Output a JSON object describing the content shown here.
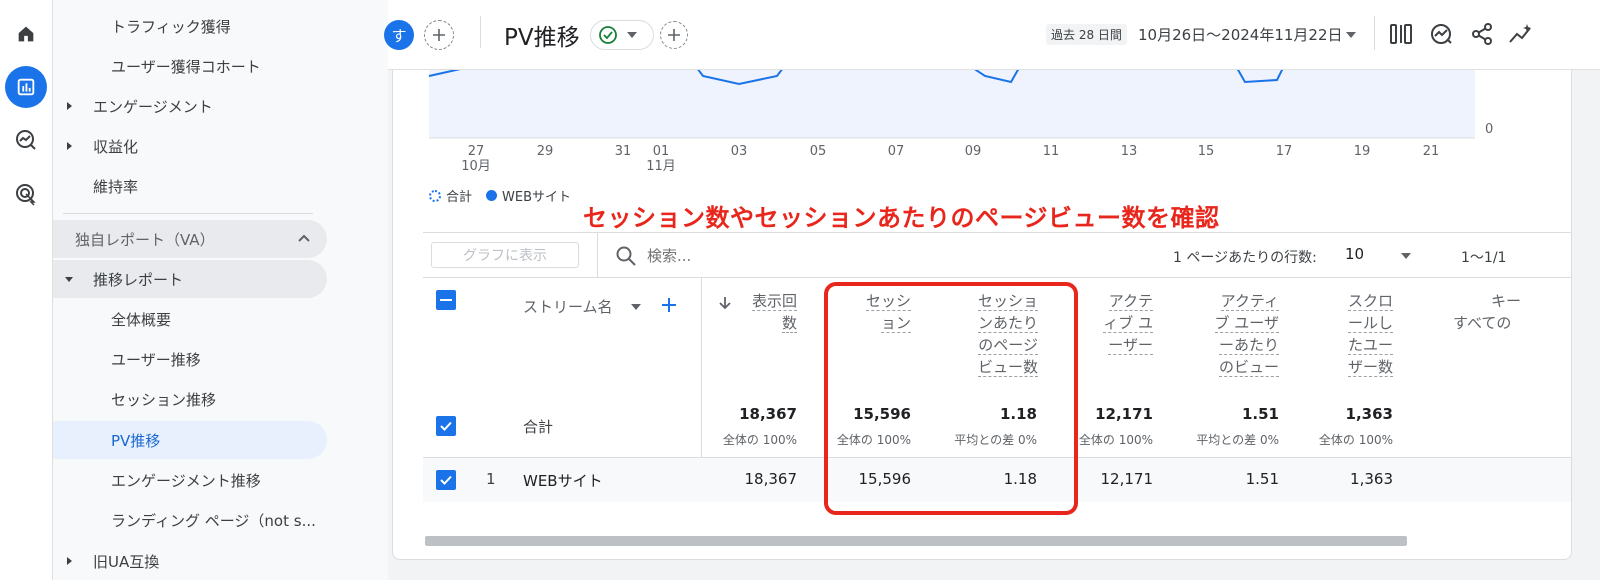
{
  "sidebar": {
    "items": [
      {
        "label": "トラフィック獲得"
      },
      {
        "label": "ユーザー獲得コホート"
      },
      {
        "label": "エンゲージメント"
      },
      {
        "label": "収益化"
      },
      {
        "label": "維持率"
      },
      {
        "label": "独自レポート（VA）"
      },
      {
        "label": "推移レポート"
      },
      {
        "label": "全体概要"
      },
      {
        "label": "ユーザー推移"
      },
      {
        "label": "セッション推移"
      },
      {
        "label": "PV推移"
      },
      {
        "label": "エンゲージメント推移"
      },
      {
        "label": "ランディング ページ（not s..."
      },
      {
        "label": "旧UA互換"
      }
    ]
  },
  "header": {
    "avatar": "す",
    "title": "PV推移",
    "date_prefix": "過去 28 日間",
    "date_range": "10月26日〜2024年11月22日"
  },
  "chart": {
    "x_ticks": [
      {
        "day": "27",
        "month": "10月"
      },
      {
        "day": "29",
        "month": ""
      },
      {
        "day": "31",
        "month": ""
      },
      {
        "day": "01",
        "month": "11月"
      },
      {
        "day": "03",
        "month": ""
      },
      {
        "day": "05",
        "month": ""
      },
      {
        "day": "07",
        "month": ""
      },
      {
        "day": "09",
        "month": ""
      },
      {
        "day": "11",
        "month": ""
      },
      {
        "day": "13",
        "month": ""
      },
      {
        "day": "15",
        "month": ""
      },
      {
        "day": "17",
        "month": ""
      },
      {
        "day": "19",
        "month": ""
      },
      {
        "day": "21",
        "month": ""
      }
    ],
    "y_zero": "0",
    "legend": {
      "total": "合計",
      "series": "WEBサイト"
    }
  },
  "annotation": {
    "text": "セッション数やセッションあたりのページビュー数を確認",
    "color": "#e8261c"
  },
  "table": {
    "plot_button": "グラフに表示",
    "search_placeholder": "検索...",
    "rows_per_page_label": "1 ページあたりの行数:",
    "rows_per_page": "10",
    "pagination": "1〜1/1",
    "dimension_header": "ストリーム名",
    "columns": [
      {
        "h": [
          "表示回",
          "数"
        ],
        "total": "18,367",
        "sub": "全体の 100%",
        "row": "18,367"
      },
      {
        "h": [
          "セッシ",
          "ョン"
        ],
        "total": "15,596",
        "sub": "全体の 100%",
        "row": "15,596"
      },
      {
        "h": [
          "セッショ",
          "ンあたり",
          "のページ",
          "ビュー数"
        ],
        "total": "1.18",
        "sub": "平均との差 0%",
        "row": "1.18"
      },
      {
        "h": [
          "アクテ",
          "ィブ ユ",
          "ーザー"
        ],
        "total": "12,171",
        "sub": "全体の 100%",
        "row": "12,171"
      },
      {
        "h": [
          "アクティ",
          "ブ ユーザ",
          "ーあたり",
          "のビュー"
        ],
        "total": "1.51",
        "sub": "平均との差 0%",
        "row": "1.51"
      },
      {
        "h": [
          "スクロ",
          "ールし",
          "たユー",
          "ザー数"
        ],
        "total": "1,363",
        "sub": "全体の 100%",
        "row": "1,363"
      },
      {
        "h": [
          "キー",
          "すべての"
        ],
        "total": "",
        "sub": "",
        "row": ""
      }
    ],
    "total_label": "合計",
    "row_index": "1",
    "row_label": "WEBサイト"
  },
  "colors": {
    "accent": "#1a73e8",
    "highlight_box": "#e8261c"
  }
}
